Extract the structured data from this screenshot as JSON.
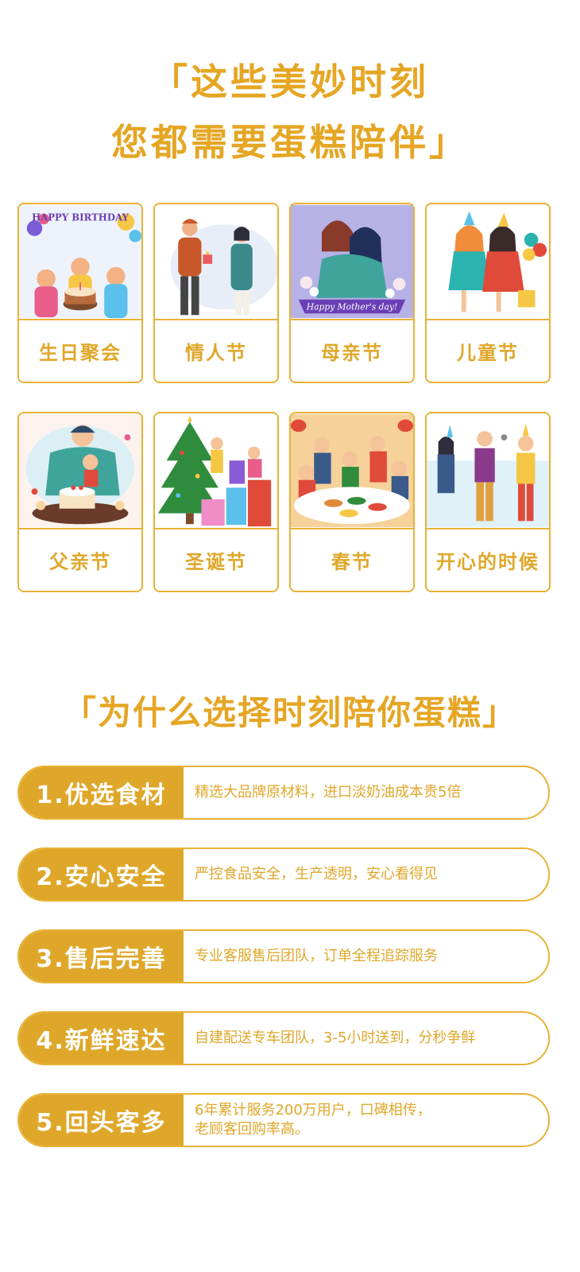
{
  "title_line1": "「这些美妙时刻",
  "title_line2": "您都需要蛋糕陪伴」",
  "occasions": [
    {
      "label": "生日聚会",
      "icon": "birthday-party-illustration",
      "banner": "HAPPY BIRTHDAY"
    },
    {
      "label": "情人节",
      "icon": "valentines-gift-illustration"
    },
    {
      "label": "母亲节",
      "icon": "mothers-day-illustration",
      "banner": "Happy Mother's day!"
    },
    {
      "label": "儿童节",
      "icon": "childrens-day-illustration"
    },
    {
      "label": "父亲节",
      "icon": "fathers-day-illustration"
    },
    {
      "label": "圣诞节",
      "icon": "christmas-tree-illustration"
    },
    {
      "label": "春节",
      "icon": "spring-festival-dinner-illustration"
    },
    {
      "label": "开心的时候",
      "icon": "happy-gathering-illustration"
    }
  ],
  "why_title": "「为什么选择时刻陪你蛋糕」",
  "reasons": [
    {
      "title": "1.优选食材",
      "desc": "精选大品牌原材料，进口淡奶油成本贵5倍"
    },
    {
      "title": "2.安心安全",
      "desc": "严控食品安全，生产透明，安心看得见"
    },
    {
      "title": "3.售后完善",
      "desc": "专业客服售后团队，订单全程追踪服务"
    },
    {
      "title": "4.新鲜速达",
      "desc": "自建配送专车团队，3-5小时送到，分秒争鲜"
    },
    {
      "title": "5.回头客多",
      "desc": "6年累计服务200万用户，口碑相传，\n老顾客回购率高。"
    }
  ],
  "colors": {
    "accent": "#DFA72A",
    "border": "#E8B235",
    "background": "#FFFFFF"
  }
}
